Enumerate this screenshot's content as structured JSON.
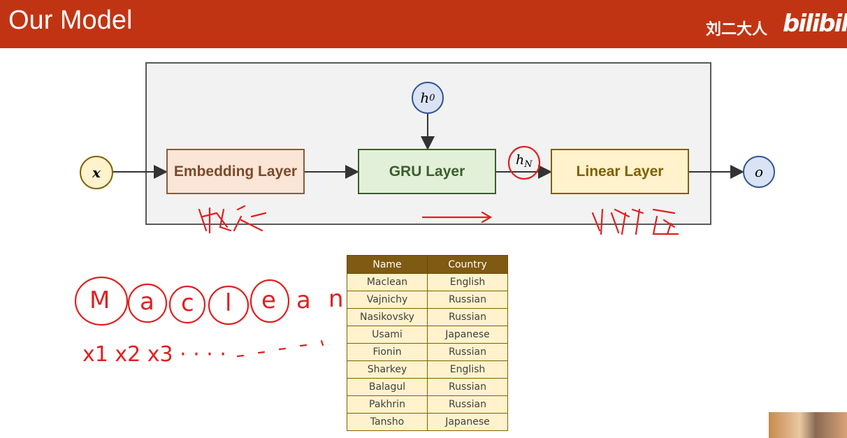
{
  "header": {
    "title": "Our Model",
    "uploader": "刘二大人",
    "logo": "bilibili"
  },
  "diagram": {
    "input": "x",
    "hidden_init": "h",
    "hidden_init_sub": "0",
    "hidden_out": "h",
    "hidden_out_sub": "N",
    "output": "o",
    "blocks": {
      "embedding": "Embedding Layer",
      "gru": "GRU Layer",
      "linear": "Linear Layer"
    }
  },
  "table": {
    "headers": [
      "Name",
      "Country"
    ],
    "rows": [
      [
        "Maclean",
        "English"
      ],
      [
        "Vajnichy",
        "Russian"
      ],
      [
        "Nasikovsky",
        "Russian"
      ],
      [
        "Usami",
        "Japanese"
      ],
      [
        "Fionin",
        "Russian"
      ],
      [
        "Sharkey",
        "English"
      ],
      [
        "Balagul",
        "Russian"
      ],
      [
        "Pakhrin",
        "Russian"
      ],
      [
        "Tansho",
        "Japanese"
      ]
    ]
  },
  "annotations": {
    "color": "#e02020",
    "letters": [
      "M",
      "a",
      "c",
      "l",
      "e",
      "a",
      "n"
    ],
    "sequence": "x1 x2 x3 · · · ·"
  }
}
